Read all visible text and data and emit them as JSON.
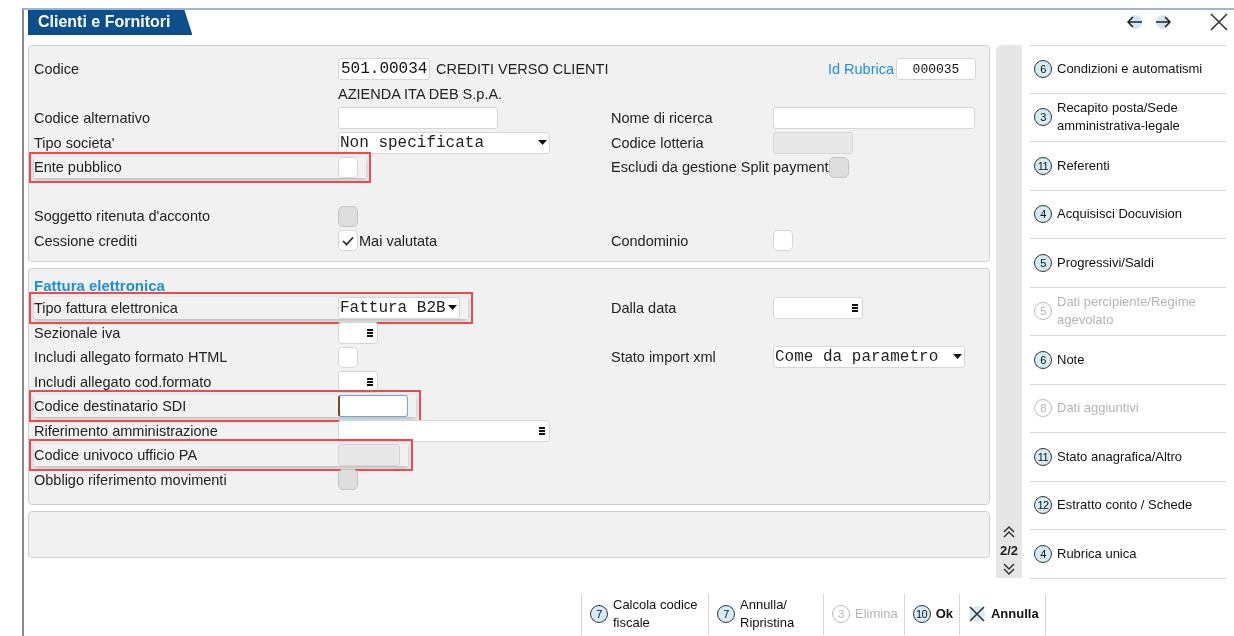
{
  "window": {
    "title": "Clienti e Fornitori"
  },
  "panels": [
    {
      "rows": [
        {
          "label": "Codice",
          "control": {
            "kind": "text",
            "value": "501.00034",
            "caption": "CREDITI VERSO CLIENTI"
          },
          "right": {
            "kind": "link",
            "label": "Id Rubrica",
            "control": {
              "kind": "text",
              "value": "000035"
            }
          }
        },
        {
          "caption": "AZIENDA ITA DEB S.p.A."
        },
        {
          "label": "Codice alternativo",
          "control": {
            "kind": "text"
          },
          "right": {
            "kind": "plain",
            "label": "Nome di ricerca",
            "control": {
              "kind": "text"
            }
          }
        },
        {
          "label": "Tipo societa'",
          "control": {
            "kind": "dropdown",
            "value": "Non specificata"
          },
          "right": {
            "kind": "plain",
            "label": "Codice lotteria",
            "control": {
              "kind": "text",
              "disabled": true
            }
          }
        },
        {
          "label": "Ente pubblico",
          "highlighted": true,
          "control": {
            "kind": "checkbox",
            "checked": false,
            "disabled": false
          },
          "right": {
            "kind": "plain",
            "label": "Escludi da gestione Split payment",
            "control": {
              "kind": "checkbox",
              "checked": false,
              "disabled": true
            }
          }
        },
        {
          "label": "Soggetto ritenuta d'acconto",
          "control": {
            "kind": "checkbox",
            "checked": false,
            "disabled": true
          }
        },
        {
          "label": "Cessione crediti",
          "control": {
            "kind": "checkbox",
            "checked": true,
            "disabled": false,
            "caption": "Mai valutata"
          },
          "right": {
            "kind": "plain",
            "label": "Condominio",
            "control": {
              "kind": "checkbox",
              "checked": false,
              "disabled": false
            }
          }
        }
      ]
    },
    {
      "title": "Fattura elettronica",
      "rows": [
        {
          "label": "Tipo fattura elettronica",
          "highlighted": true,
          "control": {
            "kind": "dropdown",
            "value": "Fattura B2B"
          },
          "right": {
            "kind": "plain",
            "label": "Dalla data",
            "control": {
              "kind": "lookup"
            }
          }
        },
        {
          "label": "Sezionale iva",
          "control": {
            "kind": "lookup"
          }
        },
        {
          "label": "Includi allegato formato HTML",
          "control": {
            "kind": "checkbox",
            "checked": false,
            "disabled": false
          },
          "right": {
            "kind": "plain",
            "label": "Stato import xml",
            "control": {
              "kind": "dropdown",
              "value": "Come da parametro"
            }
          }
        },
        {
          "label": "Includi allegato cod.formato",
          "control": {
            "kind": "lookup"
          }
        },
        {
          "label": "Codice destinatario SDI",
          "highlighted": true,
          "control": {
            "kind": "text",
            "focused": true
          }
        },
        {
          "label": "Riferimento amministrazione",
          "control": {
            "kind": "lookup"
          }
        },
        {
          "label": "Codice univoco ufficio PA",
          "highlighted": true,
          "control": {
            "kind": "text",
            "disabled": true
          }
        },
        {
          "label": "Obbligo riferimento movimenti",
          "control": {
            "kind": "checkbox",
            "checked": false,
            "disabled": true
          }
        }
      ]
    }
  ],
  "pager": "2/2",
  "sidebar": {
    "items": [
      {
        "number": "6",
        "label": "Condizioni e automatismi",
        "disabled": false
      },
      {
        "number": "3",
        "label": "Recapito posta/Sede amministrativa-legale",
        "disabled": false
      },
      {
        "number": "11",
        "label": "Referenti",
        "disabled": false
      },
      {
        "number": "4",
        "label": "Acquisisci Docuvision",
        "disabled": false
      },
      {
        "number": "5",
        "label": "Progressivi/Saldi",
        "disabled": false
      },
      {
        "number": "5",
        "label": "Dati percipiente/Regime agevolato",
        "disabled": true
      },
      {
        "number": "6",
        "label": "Note",
        "disabled": false
      },
      {
        "number": "8",
        "label": "Dati aggiuntivi",
        "disabled": true
      },
      {
        "number": "11",
        "label": "Stato anagrafica/Altro",
        "disabled": false
      },
      {
        "number": "12",
        "label": "Estratto conto / Schede",
        "disabled": false
      },
      {
        "number": "4",
        "label": "Rubrica unica",
        "disabled": false
      }
    ]
  },
  "buttons": [
    {
      "kind": "number",
      "number": "7",
      "label": "Calcola codice fiscale",
      "disabled": false
    },
    {
      "kind": "number",
      "number": "7",
      "label": "Annulla/ Ripristina",
      "disabled": false
    },
    {
      "kind": "number",
      "number": "3",
      "label": "Elimina",
      "disabled": true
    },
    {
      "kind": "number",
      "number": "10",
      "label": "Ok",
      "disabled": false
    },
    {
      "kind": "cancel",
      "label": "Annulla",
      "disabled": false
    }
  ]
}
